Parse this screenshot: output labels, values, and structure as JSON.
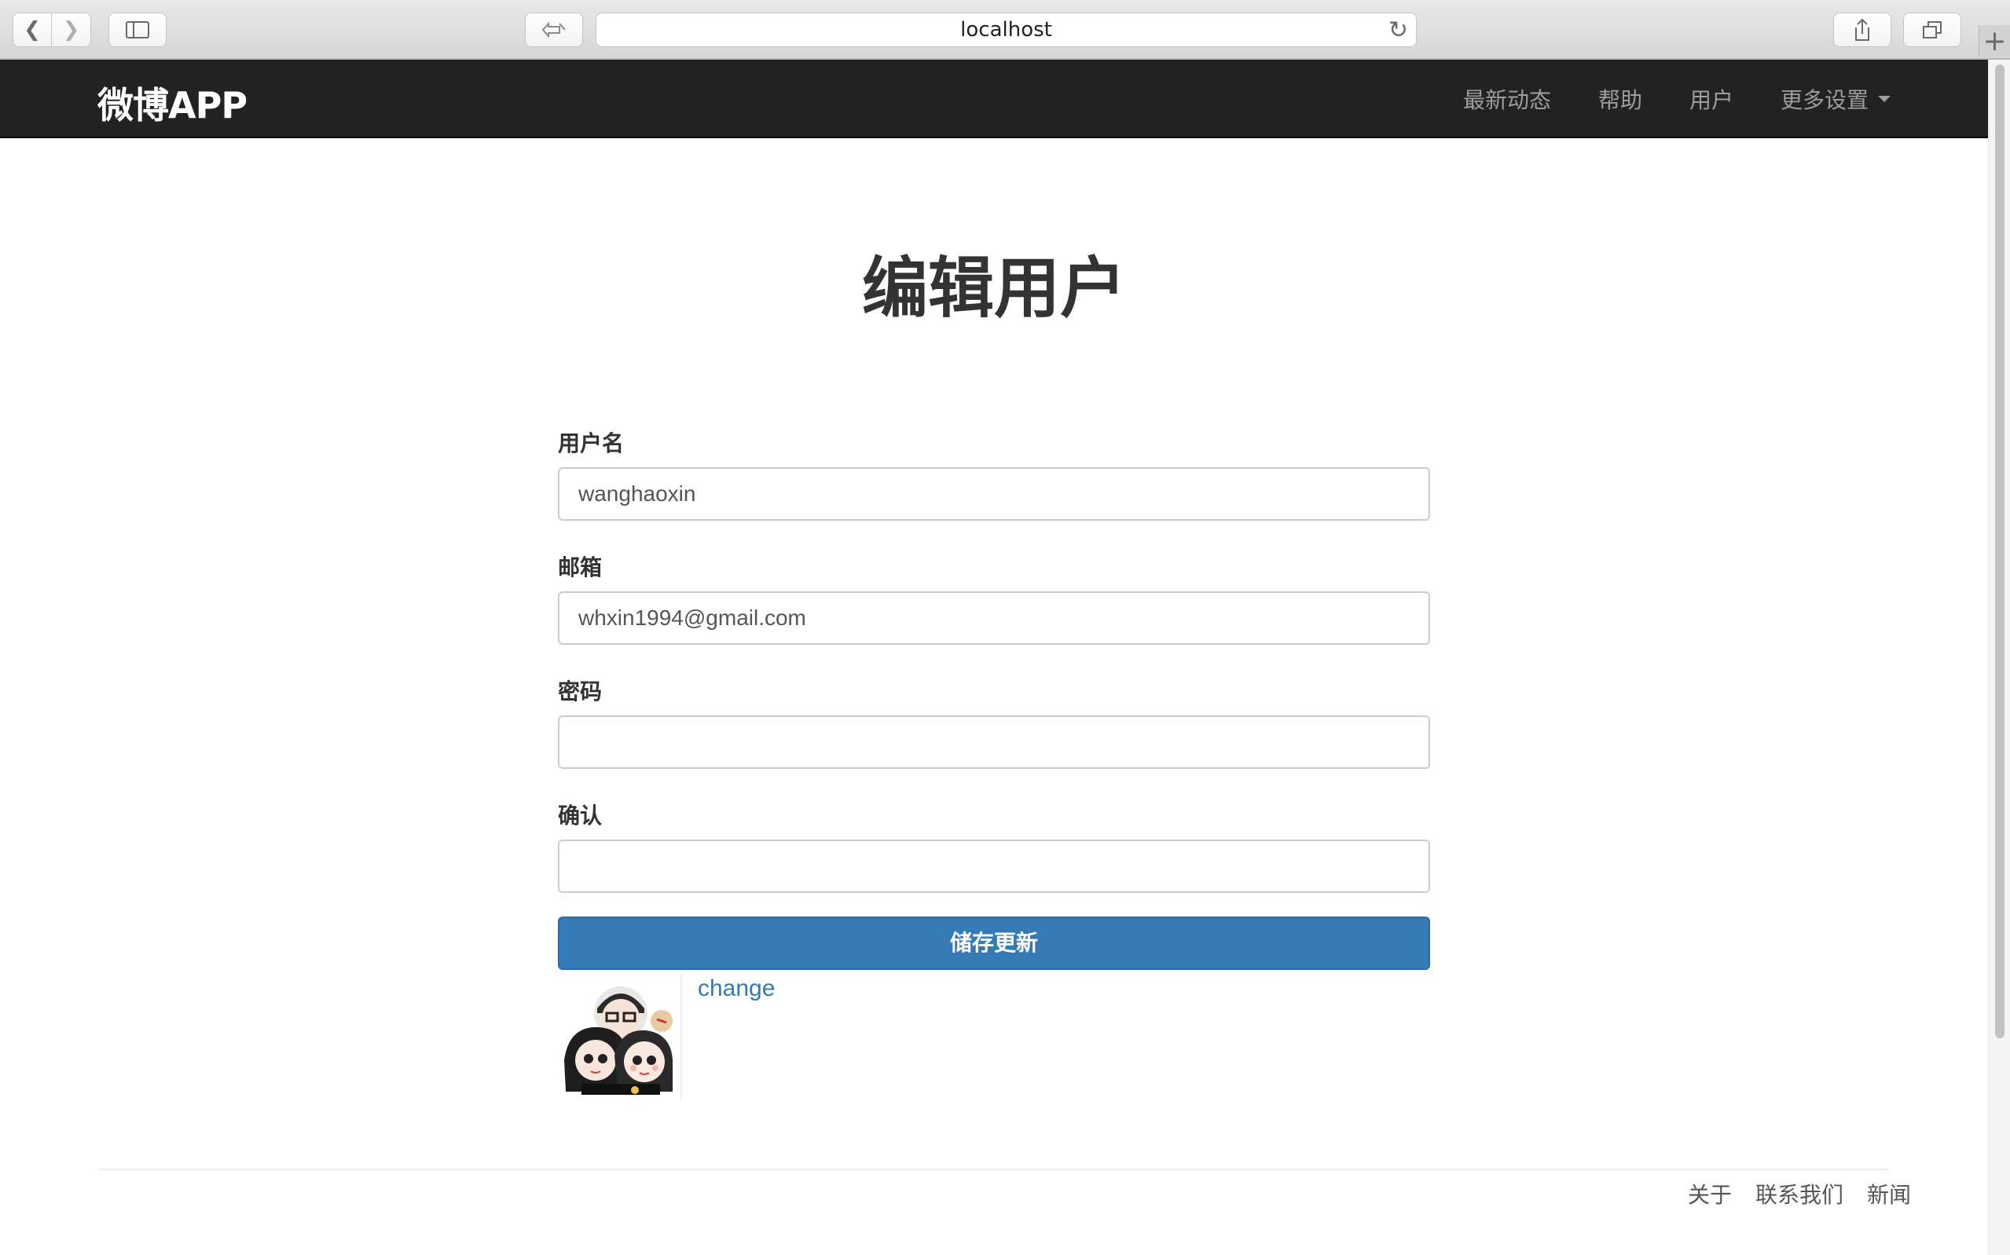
{
  "browser": {
    "url": "localhost"
  },
  "navbar": {
    "brand": "微博APP",
    "links": [
      "最新动态",
      "帮助",
      "用户",
      "更多设置"
    ]
  },
  "main": {
    "title": "编辑用户",
    "fields": {
      "username": {
        "label": "用户名",
        "value": "wanghaoxin"
      },
      "email": {
        "label": "邮箱",
        "value": "whxin1994@gmail.com"
      },
      "password": {
        "label": "密码",
        "value": ""
      },
      "confirm": {
        "label": "确认",
        "value": ""
      }
    },
    "submit_label": "储存更新",
    "avatar_change_label": "change"
  },
  "footer": {
    "links": [
      "关于",
      "联系我们",
      "新闻"
    ]
  }
}
